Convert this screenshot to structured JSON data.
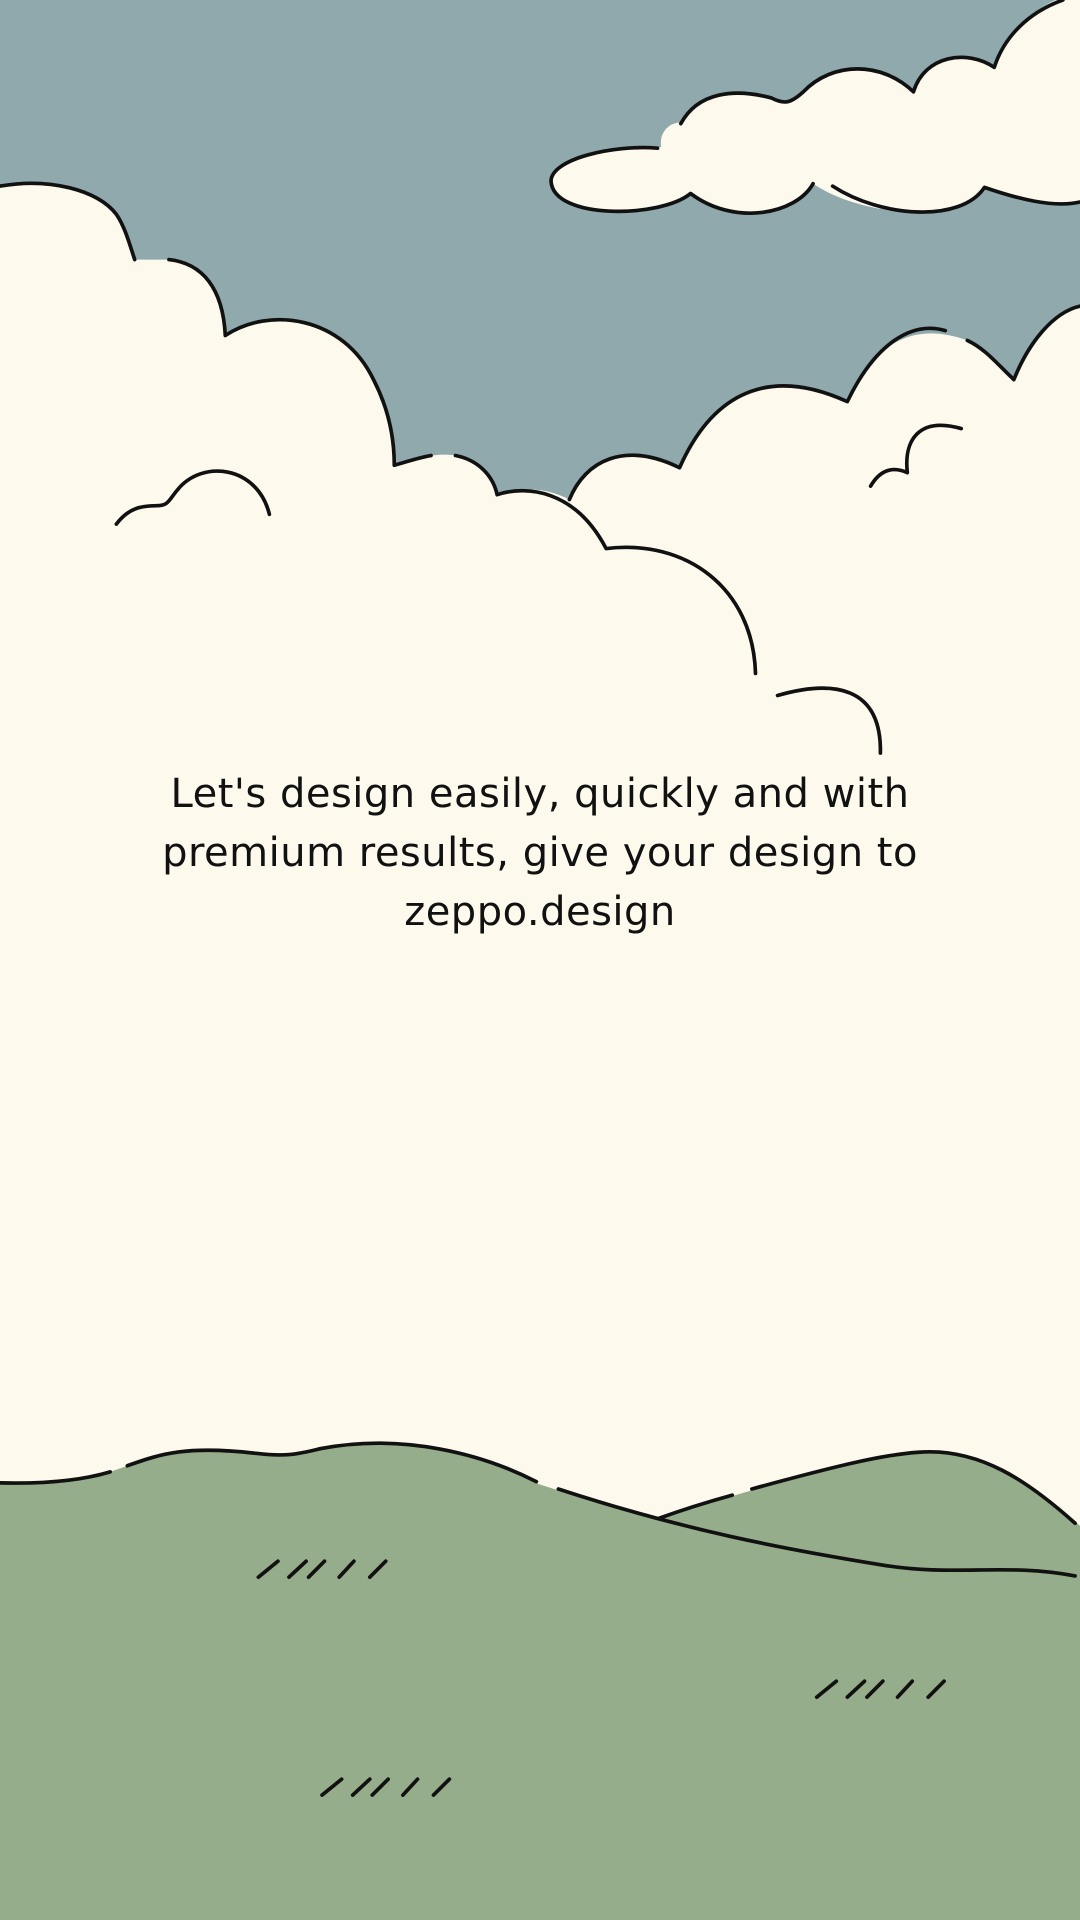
{
  "message": {
    "text": "Let's design easily, quickly and with premium results, give your design to zeppo.design"
  },
  "colors": {
    "sky": "#8fa9ad",
    "cloud": "#fdf9ec",
    "hill": "#95ad8a",
    "line": "#111111"
  }
}
